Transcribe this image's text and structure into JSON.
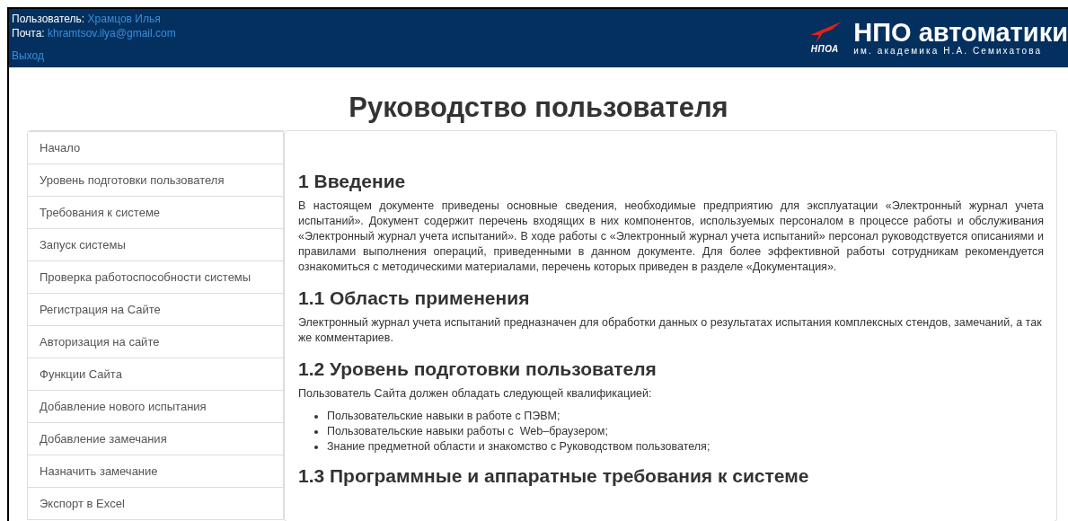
{
  "header": {
    "user_label": "Пользователь:",
    "user_name": "Храмцов Илья",
    "mail_label": "Почта:",
    "mail": "khramtsov.ilya@gmail.com",
    "logout": "Выход",
    "logo": {
      "mark": "НПОА",
      "title": "НПО автоматики",
      "subtitle": "им. академика Н.А. Семихатова"
    }
  },
  "page_title": "Руководство пользователя",
  "sidebar": {
    "items": [
      {
        "label": "Начало"
      },
      {
        "label": "Уровень подготовки пользователя"
      },
      {
        "label": "Требования к системе"
      },
      {
        "label": "Запуск системы"
      },
      {
        "label": "Проверка работоспособности системы"
      },
      {
        "label": "Регистрация на Сайте"
      },
      {
        "label": "Авторизация на сайте"
      },
      {
        "label": "Функции Сайта"
      },
      {
        "label": "Добавление нового испытания"
      },
      {
        "label": "Добавление замечания"
      },
      {
        "label": "Назначить замечание"
      },
      {
        "label": "Экспорт в Excel"
      }
    ]
  },
  "content": [
    {
      "kind": "heading",
      "text": "1 Введение"
    },
    {
      "kind": "paragraph",
      "justify": true,
      "text": "В настоящем документе приведены основные сведения, необходимые предприятию для эксплуатации «Электронный журнал учета испытаний». Документ содержит перечень входящих в них компонентов, используемых персоналом в процессе работы и обслуживания «Электронный журнал учета испытаний». В ходе работы с «Электронный журнал учета испытаний» персонал руководствуется описаниями и правилами выполнения операций, приведенными в данном документе. Для более эффективной работы сотрудникам рекомендуется ознакомиться с методическими материалами, перечень которых приведен в разделе «Документация»."
    },
    {
      "kind": "heading",
      "text": "1.1 Область применения"
    },
    {
      "kind": "paragraph",
      "justify": false,
      "text": "Электронный журнал учета испытаний предназначен для обработки данных о результатах испытания комплексных стендов, замечаний, а так же комментариев."
    },
    {
      "kind": "heading",
      "text": "1.2 Уровень подготовки пользователя"
    },
    {
      "kind": "paragraph",
      "text": "Пользователь Сайта должен обладать следующей квалификацией:"
    },
    {
      "kind": "list",
      "items": [
        "Пользовательские навыки в работе с ПЭВМ;",
        "Пользовательские навыки работы с  Web–браузером;",
        "Знание предметной области и знакомство с Руководством пользователя;"
      ]
    },
    {
      "kind": "heading",
      "text": "1.3 Программные и аппаратные требования к системе"
    }
  ]
}
